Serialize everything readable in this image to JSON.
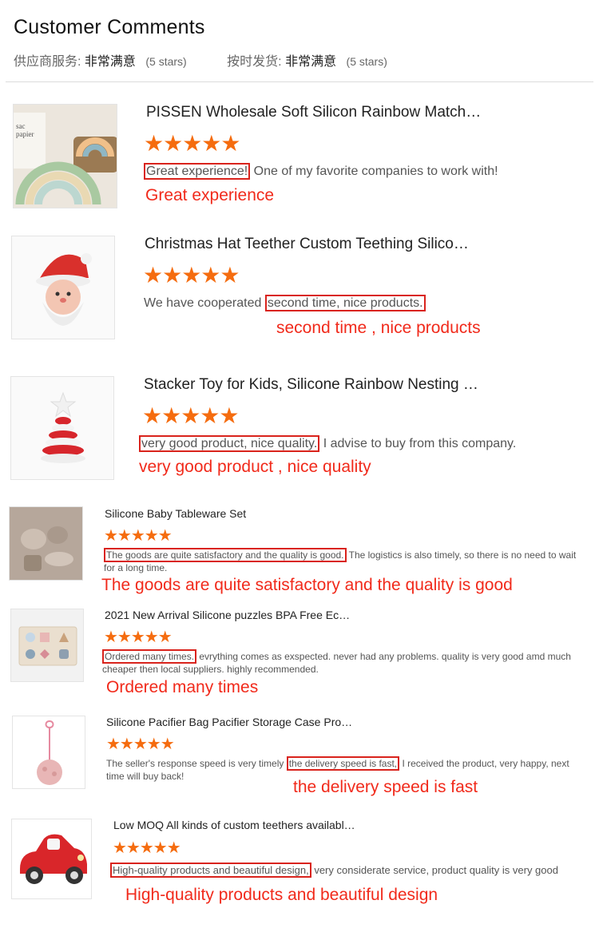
{
  "header": {
    "title": "Customer Comments",
    "ratings": [
      {
        "label": "供应商服务:",
        "value": "非常满意",
        "stars": "(5 stars)"
      },
      {
        "label": "按时发货:",
        "value": "非常满意",
        "stars": "(5 stars)"
      }
    ]
  },
  "reviews": [
    {
      "product": "PISSEN Wholesale Soft Silicon Rainbow Match…",
      "stars": "★★★★★",
      "rating": 5,
      "highlight": "Great experience!",
      "comment_pre": "",
      "comment_post": " One of my favorite companies to work with!",
      "annotation": "Great experience",
      "image": "rainbow-stacker-photo"
    },
    {
      "product": "Christmas Hat Teether Custom Teething Silico…",
      "stars": "★★★★★",
      "rating": 5,
      "highlight": "second time, nice products.",
      "comment_pre": "We have cooperated ",
      "comment_post": "",
      "annotation": "second time , nice products",
      "image": "santa-teether-photo"
    },
    {
      "product": "Stacker Toy for Kids, Silicone Rainbow Nesting …",
      "stars": "★★★★★",
      "rating": 5,
      "highlight": "very good product,  nice quality.",
      "comment_pre": "",
      "comment_post": " I advise to buy from this company.",
      "annotation": "very good product , nice quality",
      "image": "christmas-tree-stacker-photo"
    },
    {
      "product": "Silicone Baby Tableware Set",
      "stars": "★★★★★",
      "rating": 5,
      "highlight": "The goods are quite satisfactory and the quality is good.",
      "comment_pre": "",
      "comment_post": " The logistics is also timely, so there is no need to wait for a long time.",
      "annotation": "The goods are quite satisfactory and the quality is good",
      "image": "tableware-set-photo"
    },
    {
      "product": "2021 New Arrival Silicone puzzles BPA Free Ec…",
      "stars": "★★★★★",
      "rating": 5,
      "highlight": "Ordered many times.",
      "comment_pre": "",
      "comment_post": " evrything comes as exspected. never had any problems. quality is very good amd much cheaper then local suppliers. highly recommended.",
      "annotation": "Ordered many times",
      "image": "puzzle-board-photo"
    },
    {
      "product": "Silicone Pacifier Bag Pacifier Storage Case Pro…",
      "stars": "★★★★★",
      "rating": 5,
      "highlight": "the delivery speed is fast,",
      "comment_pre": "The seller's response speed is very timely ",
      "comment_post": " I received the product, very happy, next time will buy back!",
      "annotation": "the delivery speed is fast",
      "image": "pacifier-case-photo"
    },
    {
      "product": "Low MOQ All kinds of custom teethers availabl…",
      "stars": "★★★★★",
      "rating": 5,
      "highlight": "High-quality products and beautiful design,",
      "comment_pre": "",
      "comment_post": " very considerate service, product quality is very good",
      "annotation": "High-quality products and beautiful design",
      "image": "red-car-teether-photo"
    }
  ],
  "colors": {
    "star": "#f56c0f",
    "annotation": "#f12a1b",
    "highlight_box": "#d9231c"
  }
}
